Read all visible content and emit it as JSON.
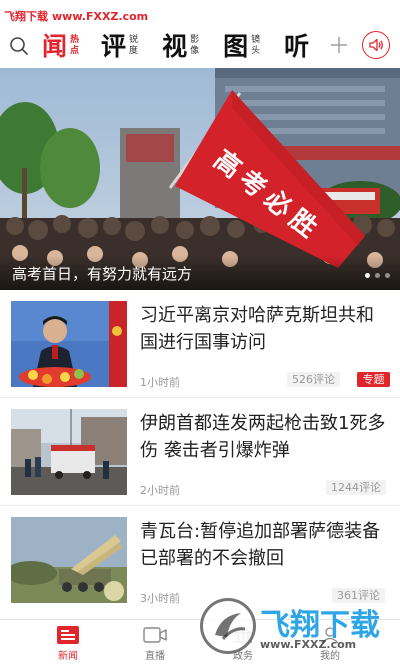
{
  "watermark": {
    "site": "飞翔下载",
    "url": "www.FXXZ.com",
    "logo_text": "飞翔下载",
    "logo_url": "www.FXXZ.com"
  },
  "header": {
    "channels": [
      {
        "big": "闻",
        "small": [
          "热",
          "点"
        ],
        "active": true
      },
      {
        "big": "评",
        "small": [
          "锐",
          "度"
        ],
        "active": false
      },
      {
        "big": "视",
        "small": [
          "影",
          "像"
        ],
        "active": false
      },
      {
        "big": "图",
        "small": [
          "镜",
          "头"
        ],
        "active": false
      },
      {
        "big": "听",
        "small": [
          "",
          ""
        ],
        "active": false
      }
    ],
    "icons": {
      "search": "search-icon",
      "add": "plus-icon",
      "audio": "speaker-icon"
    }
  },
  "hero": {
    "caption": "高考首日，有努力就有远方",
    "flag_text": "高考必胜",
    "dots": 3,
    "active_dot": 0
  },
  "news": [
    {
      "title": "习近平离京对哈萨克斯坦共和国进行国事访问",
      "time": "1小时前",
      "comments": "526评论",
      "tag": "专题"
    },
    {
      "title": "伊朗首都连发两起枪击致1死多伤 袭击者引爆炸弹",
      "time": "2小时前",
      "comments": "1244评论",
      "tag": ""
    },
    {
      "title": "青瓦台:暂停追加部署萨德装备 已部署的不会撤回",
      "time": "3小时前",
      "comments": "361评论",
      "tag": ""
    }
  ],
  "bottom_nav": [
    {
      "label": "新闻",
      "icon": "news-icon",
      "active": true
    },
    {
      "label": "直播",
      "icon": "live-icon",
      "active": false
    },
    {
      "label": "政务",
      "icon": "gov-icon",
      "active": false
    },
    {
      "label": "我的",
      "icon": "profile-icon",
      "active": false
    }
  ],
  "colors": {
    "accent": "#e0252c",
    "text": "#222222",
    "muted": "#999999"
  }
}
